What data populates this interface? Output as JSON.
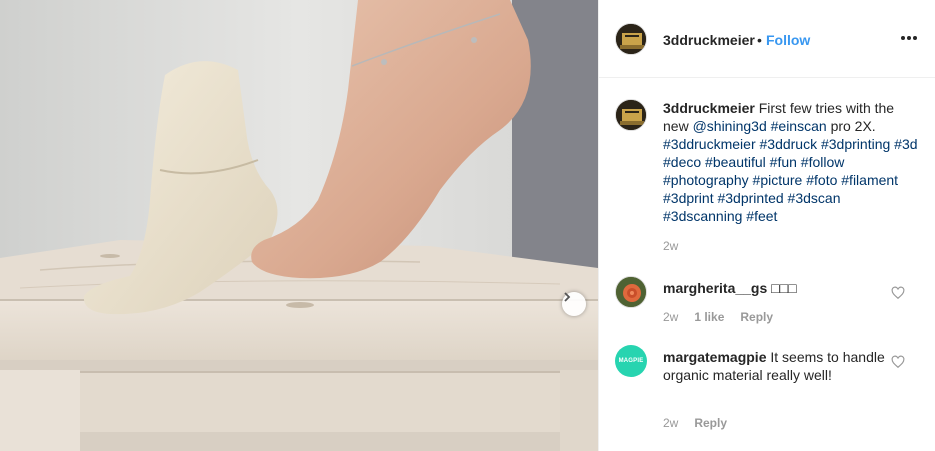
{
  "post": {
    "author": {
      "username": "3ddruckmeier",
      "separator": "•",
      "follow_label": "Follow"
    },
    "caption": {
      "username": "3ddruckmeier",
      "text": "First few tries with the new ",
      "mention": "@shining3d",
      "hashtags": [
        "#einscan",
        "pro 2X.",
        "#3ddruckmeier",
        "#3ddruck",
        "#3dprinting",
        "#3d",
        "#deco",
        "#beautiful",
        "#fun",
        "#follow",
        "#photography",
        "#picture",
        "#foto",
        "#filament",
        "#3dprint",
        "#3dprinted",
        "#3dscan",
        "#3dscanning",
        "#feet"
      ],
      "time": "2w"
    },
    "comments": [
      {
        "username": "margherita__gs",
        "text": "□□□",
        "time": "2w",
        "likes": "1 like",
        "reply_label": "Reply"
      },
      {
        "username": "margatemagpie",
        "avatar_text": "MAGPIE",
        "text": "It seems to handle organic material really well!",
        "time": "2w",
        "reply_label": "Reply"
      }
    ]
  },
  "colors": {
    "link": "#3897f0",
    "hashtag": "#003569",
    "muted": "#999999",
    "text": "#262626"
  },
  "icons": {
    "next": "chevron-right-icon",
    "more": "more-horizontal-icon",
    "like": "heart-icon"
  }
}
